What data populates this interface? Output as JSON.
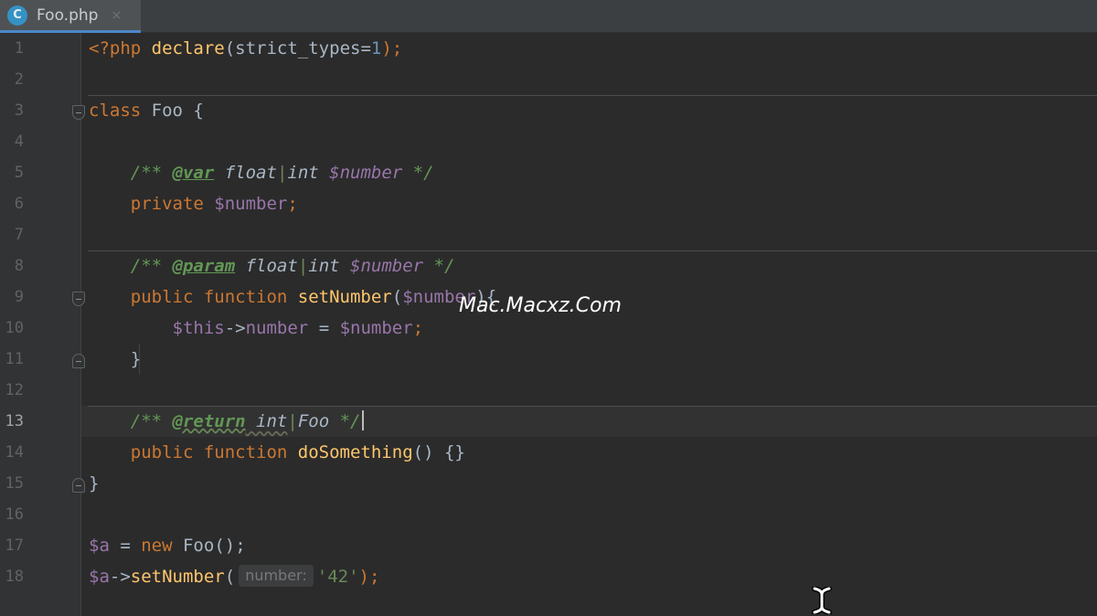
{
  "tab": {
    "icon_letter": "C",
    "icon_name": "php-class-icon",
    "filename": "Foo.php",
    "close_glyph": "×"
  },
  "editor": {
    "current_line": 13,
    "line_numbers": [
      "1",
      "2",
      "3",
      "4",
      "5",
      "6",
      "7",
      "8",
      "9",
      "10",
      "11",
      "12",
      "13",
      "14",
      "15",
      "16",
      "17",
      "18"
    ],
    "code": {
      "l1": {
        "open": "<?php",
        "declare": "declare",
        "paren_open": "(strict_types=",
        "num": "1",
        "paren_close": ");"
      },
      "l3": {
        "kw": "class",
        "name": " Foo {"
      },
      "l5": {
        "open": "/** ",
        "tag": "@var",
        "t1": " float",
        "bar": "|",
        "t2": "int",
        "var": " $number",
        "close": " */"
      },
      "l6": {
        "kw": "private",
        "var": " $number",
        "semi": ";"
      },
      "l8": {
        "open": "/** ",
        "tag": "@param",
        "t1": " float",
        "bar": "|",
        "t2": "int",
        "var": " $number",
        "close": " */"
      },
      "l9": {
        "kw1": "public",
        "kw2": " function",
        "fn": " setNumber",
        "po": "(",
        "var": "$number",
        "pc": "){"
      },
      "l10": {
        "this": "$this",
        "arrow": "->",
        "prop": "number",
        "eq": " = ",
        "var": "$number",
        "semi": ";"
      },
      "l11": {
        "brace": "}"
      },
      "l13": {
        "open": "/** ",
        "tag": "@return",
        "t1": " int",
        "bar": "|",
        "t2": "Foo",
        "close": " */"
      },
      "l14": {
        "kw1": "public",
        "kw2": " function",
        "fn": " doSomething",
        "rest": "() {}"
      },
      "l15": {
        "brace": "}"
      },
      "l17": {
        "var": "$a",
        "eq": " = ",
        "kw": "new",
        "cls": " Foo",
        "rest": "();"
      },
      "l18": {
        "var": "$a",
        "arrow": "->",
        "fn": "setNumber",
        "po": "(",
        "hint": "number:",
        "str": "'42'",
        "pc": ");"
      }
    }
  },
  "watermark": "Mac.Macxz.Com",
  "cursor_icon": "text-cursor-icon",
  "colors": {
    "keyword": "#cc7832",
    "number": "#6897bb",
    "variable": "#9876aa",
    "function": "#ffc66d",
    "doc_comment": "#629755",
    "string": "#6a8759",
    "tab_accent": "#4a88c7"
  }
}
